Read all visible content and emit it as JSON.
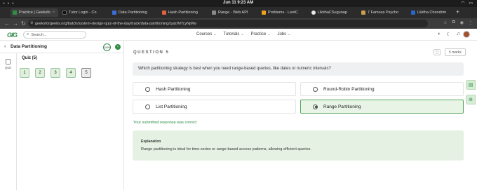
{
  "os": {
    "clock": "Jun 11   9:23 AM"
  },
  "browser": {
    "tabs": [
      {
        "label": "Practice | Geeksfo",
        "color": "#2f8d46",
        "active": true
      },
      {
        "label": "Tutor Login - Co",
        "color": "#111111",
        "active": false
      },
      {
        "label": "Data Partitioning",
        "color": "#3b6fd6",
        "active": false
      },
      {
        "label": "Hash Partitioning",
        "color": "#e06040",
        "active": false
      },
      {
        "label": "Range - Web API",
        "color": "#8a8a8a",
        "active": false
      },
      {
        "label": "Problems - LeetC",
        "color": "#f0a020",
        "active": false
      },
      {
        "label": "LikithaCSugunap",
        "color": "#e8e8e8",
        "active": false
      },
      {
        "label": "7 Famous Psycho",
        "color": "#c8a050",
        "active": false
      },
      {
        "label": "Likitha Chendrim",
        "color": "#2a66c8",
        "active": false
      }
    ],
    "url": "geeksforgeeks.org/batch/system-design-quiz-of-the-day/track/data-partitioning/quiz/MTcyNjMw"
  },
  "site": {
    "logo": "GfG",
    "search_placeholder": "Search...",
    "nav": [
      {
        "label": "Courses"
      },
      {
        "label": "Tutorials"
      },
      {
        "label": "Practice"
      },
      {
        "label": "Jobs"
      }
    ]
  },
  "sidebar": {
    "title": "Data Partitioning",
    "progress": "100%",
    "rail_label": "Quiz",
    "quiz_title": "Quiz (5)",
    "questions": [
      "1",
      "2",
      "3",
      "4",
      "5"
    ],
    "current_question_index": 4
  },
  "question": {
    "label": "QUESTION 5",
    "marks": "5 marks",
    "text": "Which partitioning strategy is best when you need range-based queries, like dates or numeric intervals?",
    "options": [
      {
        "label": "Hash Partitioning",
        "selected": false
      },
      {
        "label": "Round-Robin Partitioning",
        "selected": false
      },
      {
        "label": "List Partitioning",
        "selected": false
      },
      {
        "label": "Range Partitioning",
        "selected": true
      }
    ],
    "feedback": "Your submitted response was correct",
    "explanation_heading": "Explanation",
    "explanation_text": "Range partitioning is ideal for time-series or range-based access patterns, allowing efficient queries."
  },
  "colors": {
    "brand_green": "#2f8d46",
    "correct_bg": "#e8f5e6",
    "explanation_bg": "#e5f2e3"
  }
}
